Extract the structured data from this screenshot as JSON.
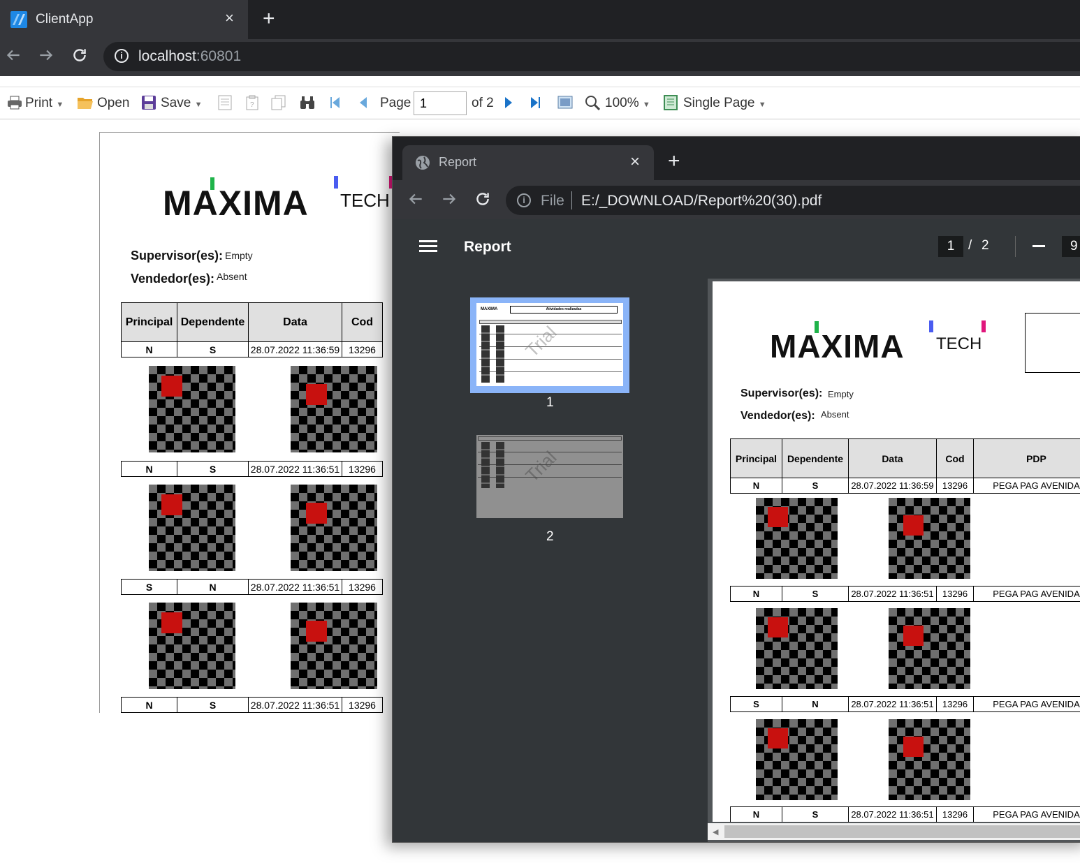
{
  "browser": {
    "tab_title": "ClientApp",
    "close_glyph": "×",
    "new_tab_glyph": "+",
    "address_host": "localhost",
    "address_port": ":60801"
  },
  "toolbar": {
    "print_label": "Print",
    "open_label": "Open",
    "save_label": "Save",
    "page_label": "Page",
    "page_value": "1",
    "page_of": "of 2",
    "zoom_label": "100%",
    "view_mode_label": "Single Page"
  },
  "report": {
    "logo_main": "MAXIMA",
    "logo_tech": "TECH",
    "supervisor_label": "Supervisor(es):",
    "supervisor_value": "Empty",
    "vendedor_label": "Vendedor(es):",
    "vendedor_value": "Absent",
    "columns": [
      "Principal",
      "Dependente",
      "Data",
      "Cod",
      "PDP"
    ],
    "rows": [
      {
        "principal": "N",
        "dependente": "S",
        "data": "28.07.2022 11:36:59",
        "cod": "13296",
        "pdp": "PEGA PAG AVENIDA"
      },
      {
        "principal": "N",
        "dependente": "S",
        "data": "28.07.2022 11:36:51",
        "cod": "13296",
        "pdp": "PEGA PAG AVENIDA"
      },
      {
        "principal": "S",
        "dependente": "N",
        "data": "28.07.2022 11:36:51",
        "cod": "13296",
        "pdp": "PEGA PAG AVENIDA"
      },
      {
        "principal": "N",
        "dependente": "S",
        "data": "28.07.2022 11:36:51",
        "cod": "13296",
        "pdp": "PEGA PAG AVENIDA"
      }
    ]
  },
  "pdf_viewer": {
    "tab_title": "Report",
    "address_scheme": "File",
    "address_path": "E:/_DOWNLOAD/Report%20(30).pdf",
    "header_title": "Report",
    "current_page": "1",
    "page_separator": "/",
    "total_pages": "2",
    "zoom_partial": "9",
    "thumbnails": [
      {
        "label": "1",
        "title": "Atividades realizadas",
        "watermark": "Trial"
      },
      {
        "label": "2",
        "watermark": "Trial"
      }
    ]
  },
  "colors": {
    "logo_green": "#1fb34a",
    "logo_blue": "#4a5cf0",
    "logo_pink": "#e0177c",
    "photo_red": "#c8110f",
    "thumb_selected": "#8ab4f8"
  }
}
